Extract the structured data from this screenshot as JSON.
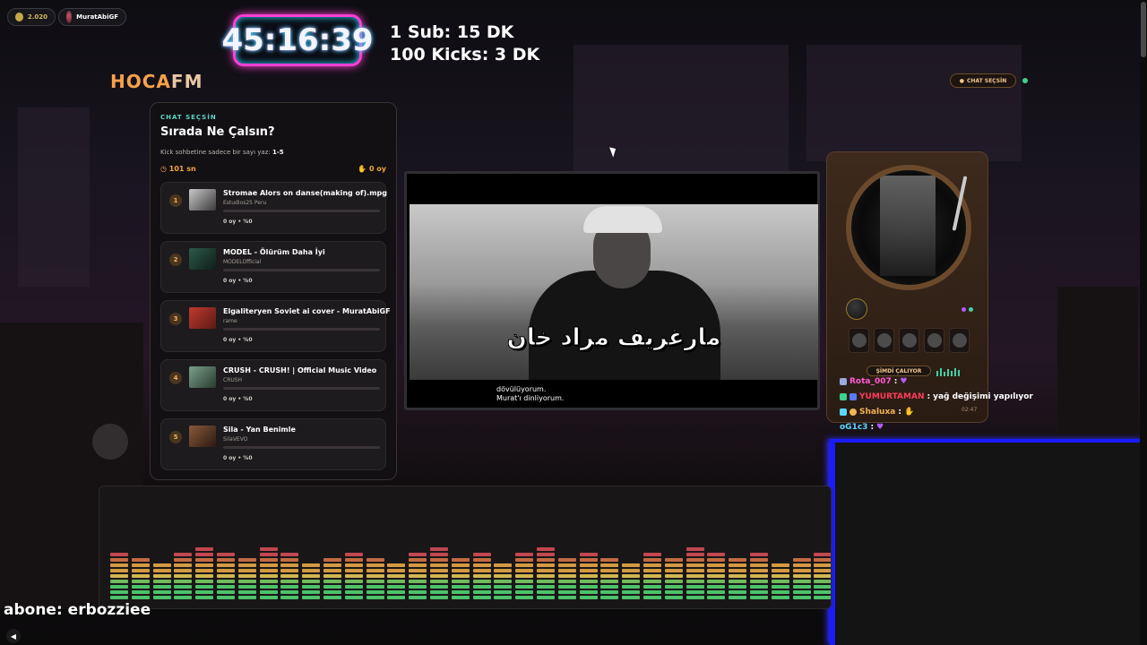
{
  "top_bar": {
    "coins": "2.020",
    "username": "MuratAbiGF"
  },
  "timer": "45:16:39",
  "promo": {
    "line1": "1 Sub: 15 DK",
    "line2": "100 Kicks: 3 DK"
  },
  "logo": {
    "part1": "HOCA",
    "part2": "FM"
  },
  "header": {
    "chat_select_button": "CHAT SEÇSİN"
  },
  "vote_panel": {
    "kicker": "CHAT SEÇSİN",
    "title": "Sırada Ne Çalsın?",
    "desc_prefix": "Kick sohbetine sadece bir sayı yaz:",
    "desc_range": "1-5",
    "timer": "101 sn",
    "total_votes": "0 oy",
    "songs": [
      {
        "num": "1",
        "title": "Stromae Alors on danse(making of).mpg",
        "channel": "Estudios25 Peru",
        "stat": "0 oy • %0",
        "percent": 0
      },
      {
        "num": "2",
        "title": "MODEL - Ölürüm Daha İyi",
        "channel": "MODELOfficial",
        "stat": "0 oy • %0",
        "percent": 0
      },
      {
        "num": "3",
        "title": "Elgaliteryen Soviet ai cover - MuratAbiGF",
        "channel": "rame",
        "stat": "0 oy • %0",
        "percent": 0
      },
      {
        "num": "4",
        "title": "CRUSH - CRUSH! | Official Music Video",
        "channel": "CRUSH",
        "stat": "0 oy • %0",
        "percent": 0
      },
      {
        "num": "5",
        "title": "Sila - Yan Benimle",
        "channel": "SilaVEVO",
        "stat": "0 oy • %0",
        "percent": 0
      }
    ]
  },
  "video": {
    "overlay_text": "مارغريف مراد خان",
    "subtitle_line1": "dövülüyorum.",
    "subtitle_line2": "Murat'ı dinliyorum."
  },
  "turntable": {
    "now_playing": "ŞİMDİ ÇALIYOR",
    "time": "02:47"
  },
  "chat": [
    {
      "user": "Rota_007",
      "sep": ":",
      "message": "",
      "user_color": "#ff5ad6"
    },
    {
      "user": "YUMURTAMAN",
      "sep": ":",
      "message": "yağ değişimi yapılıyor",
      "user_color": "#ff3b5c"
    },
    {
      "user": "Shaluxa",
      "sep": ":",
      "message": "",
      "user_color": "#f6b356"
    },
    {
      "user": "oG1c3",
      "sep": ":",
      "message": "",
      "user_color": "#5ad7ff"
    }
  ],
  "subscriber_alert": "abone: erbozziee",
  "colors": {
    "accent": "#f6a24b",
    "teal": "#5ad7c8",
    "timer_glow": "#ff3fd4",
    "webcam_border": "#1a1cff"
  }
}
